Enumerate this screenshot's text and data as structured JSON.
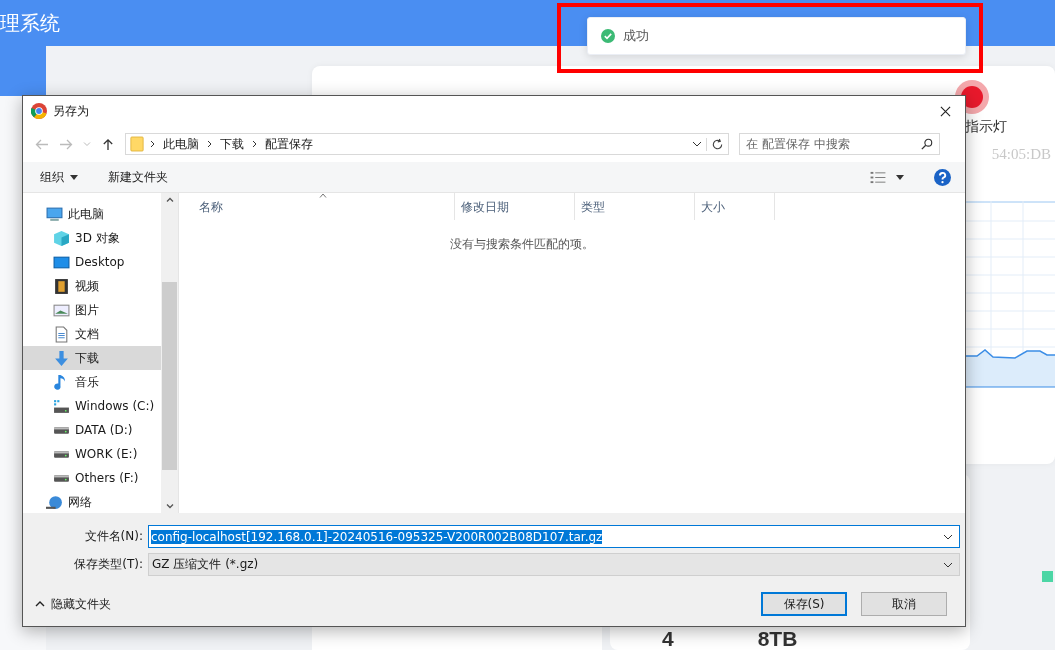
{
  "app": {
    "title_fragment": "理系统",
    "indicator_label": "指示灯",
    "mac_fragment": "54:05:DB",
    "stat_1": "4",
    "stat_2": "8TB"
  },
  "toast": {
    "message": "成功",
    "kind": "success",
    "highlighted": true
  },
  "dialog": {
    "title": "另存为",
    "breadcrumb": [
      "此电脑",
      "下载",
      "配置保存"
    ],
    "search": {
      "placeholder": "在 配置保存 中搜索"
    },
    "toolbar": [
      "组织",
      "新建文件夹"
    ],
    "nav_items": [
      {
        "label": "此电脑",
        "selected": false,
        "children": [
          {
            "label": "3D 对象",
            "selected": false
          },
          {
            "label": "Desktop",
            "selected": false
          },
          {
            "label": "视频",
            "selected": false
          },
          {
            "label": "图片",
            "selected": false
          },
          {
            "label": "文档",
            "selected": false
          },
          {
            "label": "下载",
            "selected": true
          },
          {
            "label": "音乐",
            "selected": false
          },
          {
            "label": "Windows (C:)",
            "selected": false
          },
          {
            "label": "DATA (D:)",
            "selected": false
          },
          {
            "label": "WORK (E:)",
            "selected": false
          },
          {
            "label": "Others (F:)",
            "selected": false
          }
        ]
      },
      {
        "label": "网络",
        "selected": false
      }
    ],
    "columns": [
      "名称",
      "修改日期",
      "类型",
      "大小"
    ],
    "empty_message": "没有与搜索条件匹配的项。",
    "file_name": {
      "label": "文件名(N):",
      "value": "config-localhost[192.168.0.1]-20240516-095325-V200R002B08D107.tar.gz"
    },
    "file_type": {
      "label": "保存类型(T):",
      "value": "GZ 压缩文件 (*.gz)"
    },
    "hide_folders": "隐藏文件夹",
    "buttons": [
      {
        "label": "保存(S)",
        "primary": true
      },
      {
        "label": "取消",
        "primary": false
      }
    ]
  }
}
